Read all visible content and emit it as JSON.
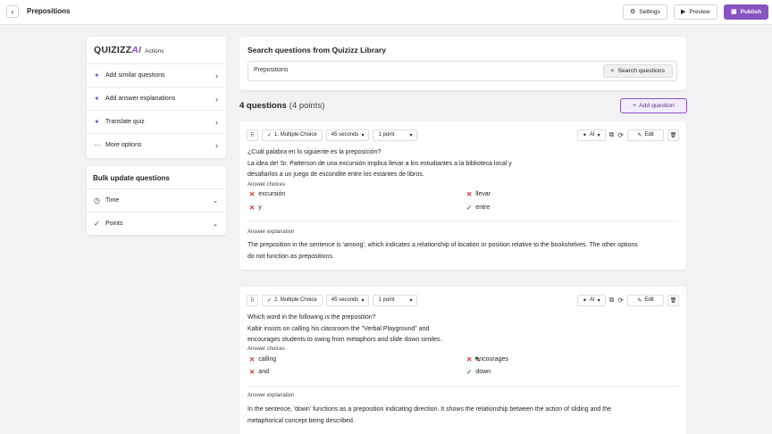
{
  "topbar": {
    "title": "Prepositions",
    "settings_label": "Settings",
    "preview_label": "Preview",
    "publish_label": "Publish",
    "accent_color": "#8854c0"
  },
  "ai_panel": {
    "logo_text": "QUIZIZZ",
    "logo_ai": "AI",
    "subtitle": "Actions",
    "items": [
      {
        "label": "Add similar questions",
        "icon": "sparkle-icon"
      },
      {
        "label": "Add answer explanations",
        "icon": "sparkle-icon"
      },
      {
        "label": "Translate quiz",
        "icon": "sparkle-icon"
      },
      {
        "label": "More options",
        "icon": "more-icon"
      }
    ]
  },
  "bulk": {
    "title": "Bulk update questions",
    "items": [
      {
        "label": "Time",
        "icon": "clock-icon"
      },
      {
        "label": "Points",
        "icon": "check-icon"
      }
    ]
  },
  "search": {
    "title": "Search questions from Quizizz Library",
    "value": "Prepositions",
    "button_label": "Search questions"
  },
  "questions_header": {
    "count": "4 questions",
    "points": "(4 points)",
    "add_label": "Add question"
  },
  "questions": [
    {
      "type_label": "1. Multiple Choice",
      "time": "45 seconds",
      "points": "1 point",
      "ai_label": "AI",
      "edit_label": "Edit",
      "lines": [
        "¿Cuál palabra en lo siguiente es la preposición?",
        "La idea de! Sr. Patterson de una excursión implica llevar a los estudiantes a la biblioteca local y",
        "desafiarlos a un juego de escondite entre los estantes de libros."
      ],
      "answers_title": "Answer choices",
      "answers": [
        {
          "text": "excursión",
          "correct": false
        },
        {
          "text": "llevar",
          "correct": false
        },
        {
          "text": "y",
          "correct": false
        },
        {
          "text": "entre",
          "correct": true
        }
      ],
      "explanation_title": "Answer explanation",
      "explanation": [
        "The preposition in the sentence is 'among', which indicates a relationship of location or position relative to the bookshelves. The other options",
        "do not function as prepositions."
      ]
    },
    {
      "type_label": "2. Multiple Choice",
      "time": "45 seconds",
      "points": "1 point",
      "ai_label": "AI",
      "edit_label": "Edit",
      "lines": [
        "Which word in the following is the preposition?",
        "Kabir insists on calling his classroom the \"Verbal Playground\" and",
        "encourages students to swing from metaphors and slide down similes."
      ],
      "answers_title": "Answer choices",
      "answers": [
        {
          "text": "calling",
          "correct": false
        },
        {
          "text": "encourages",
          "correct": false
        },
        {
          "text": "and",
          "correct": false
        },
        {
          "text": "down",
          "correct": true
        }
      ],
      "explanation_title": "Answer explanation",
      "explanation": [
        "In the sentence, 'down' functions as a preposition indicating direction. It shows the relationship between the action of sliding and the",
        "metaphorical concept being described."
      ]
    }
  ]
}
